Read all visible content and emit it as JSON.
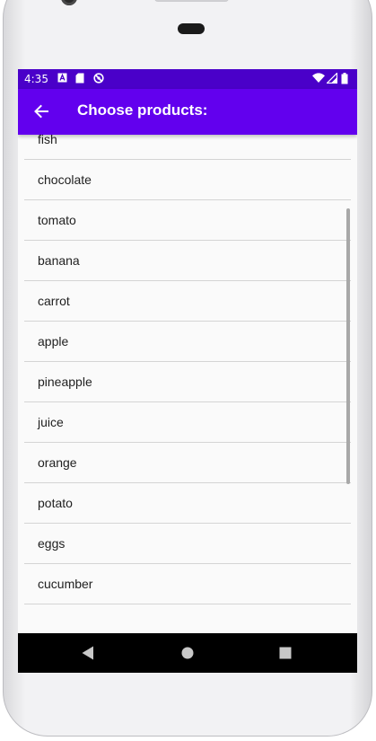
{
  "status_bar": {
    "time": "4:35",
    "left_icons": [
      "a-notification-icon",
      "sd-card-icon",
      "no-sync-icon"
    ],
    "right_icons": [
      "wifi-icon",
      "cell-signal-icon",
      "battery-icon"
    ],
    "background": "#4a00c9"
  },
  "app_bar": {
    "title": "Choose products:",
    "background": "#6200ee",
    "back_icon": "arrow-back-icon"
  },
  "products": {
    "items": [
      {
        "label": ""
      },
      {
        "label": "fish"
      },
      {
        "label": "chocolate"
      },
      {
        "label": "tomato"
      },
      {
        "label": "banana"
      },
      {
        "label": "carrot"
      },
      {
        "label": "apple"
      },
      {
        "label": "pineapple"
      },
      {
        "label": "juice"
      },
      {
        "label": "orange"
      },
      {
        "label": "potato"
      },
      {
        "label": "eggs"
      },
      {
        "label": "cucumber"
      }
    ]
  },
  "nav_bar": {
    "icons": [
      "nav-back-icon",
      "nav-home-icon",
      "nav-recents-icon"
    ],
    "background": "#000000"
  }
}
